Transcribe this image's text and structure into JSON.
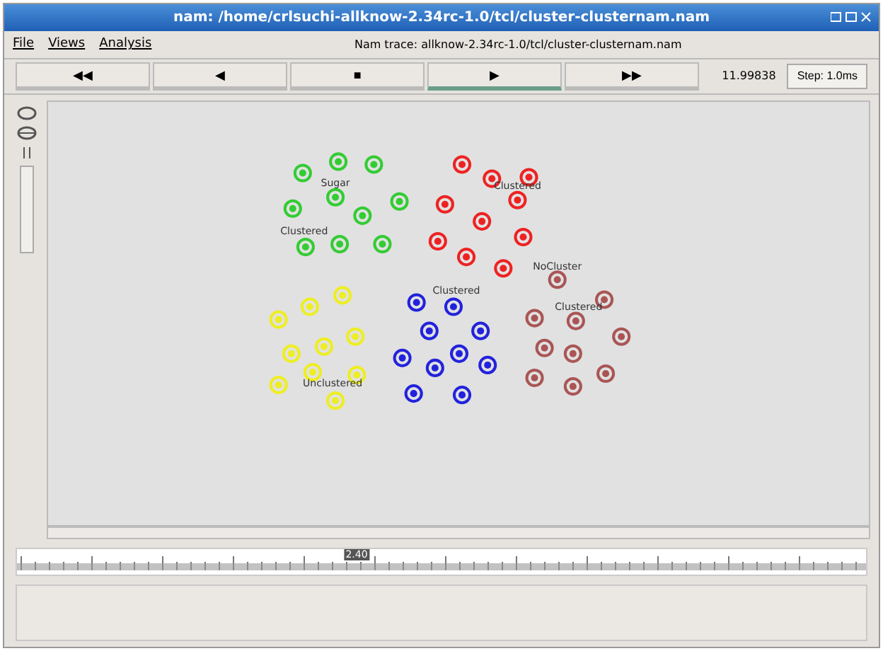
{
  "window": {
    "title": "nam: /home/crlsuchi-allknow-2.34rc-1.0/tcl/cluster-clusternam.nam"
  },
  "menu": [
    "File",
    "Views",
    "Analysis"
  ],
  "trace_name": "Nam trace: allknow-2.34rc-1.0/tcl/cluster-clusternam.nam",
  "controls": [
    {
      "symbol": "◀◀",
      "selected": false
    },
    {
      "symbol": "◀",
      "selected": false
    },
    {
      "symbol": "■",
      "selected": false
    },
    {
      "symbol": "▶",
      "selected": true
    },
    {
      "symbol": "▶▶",
      "selected": false
    }
  ],
  "time": "11.99838",
  "step": "Step: 1.0ms",
  "clusters": [
    {
      "color": "#33cc33",
      "labels": [
        "Sugar",
        "Clustered"
      ]
    },
    {
      "color": "#ee2222",
      "labels": [
        "Clustered"
      ]
    },
    {
      "color": "#eeee22",
      "labels": [
        "Unclustered"
      ]
    },
    {
      "color": "#2222dd",
      "labels": [
        "Clustered"
      ]
    },
    {
      "color": "#aa5555",
      "labels": [
        "NoCluster",
        "Clustered"
      ]
    }
  ],
  "timeline": {
    "marker": "2.40",
    "level": 0.4
  }
}
